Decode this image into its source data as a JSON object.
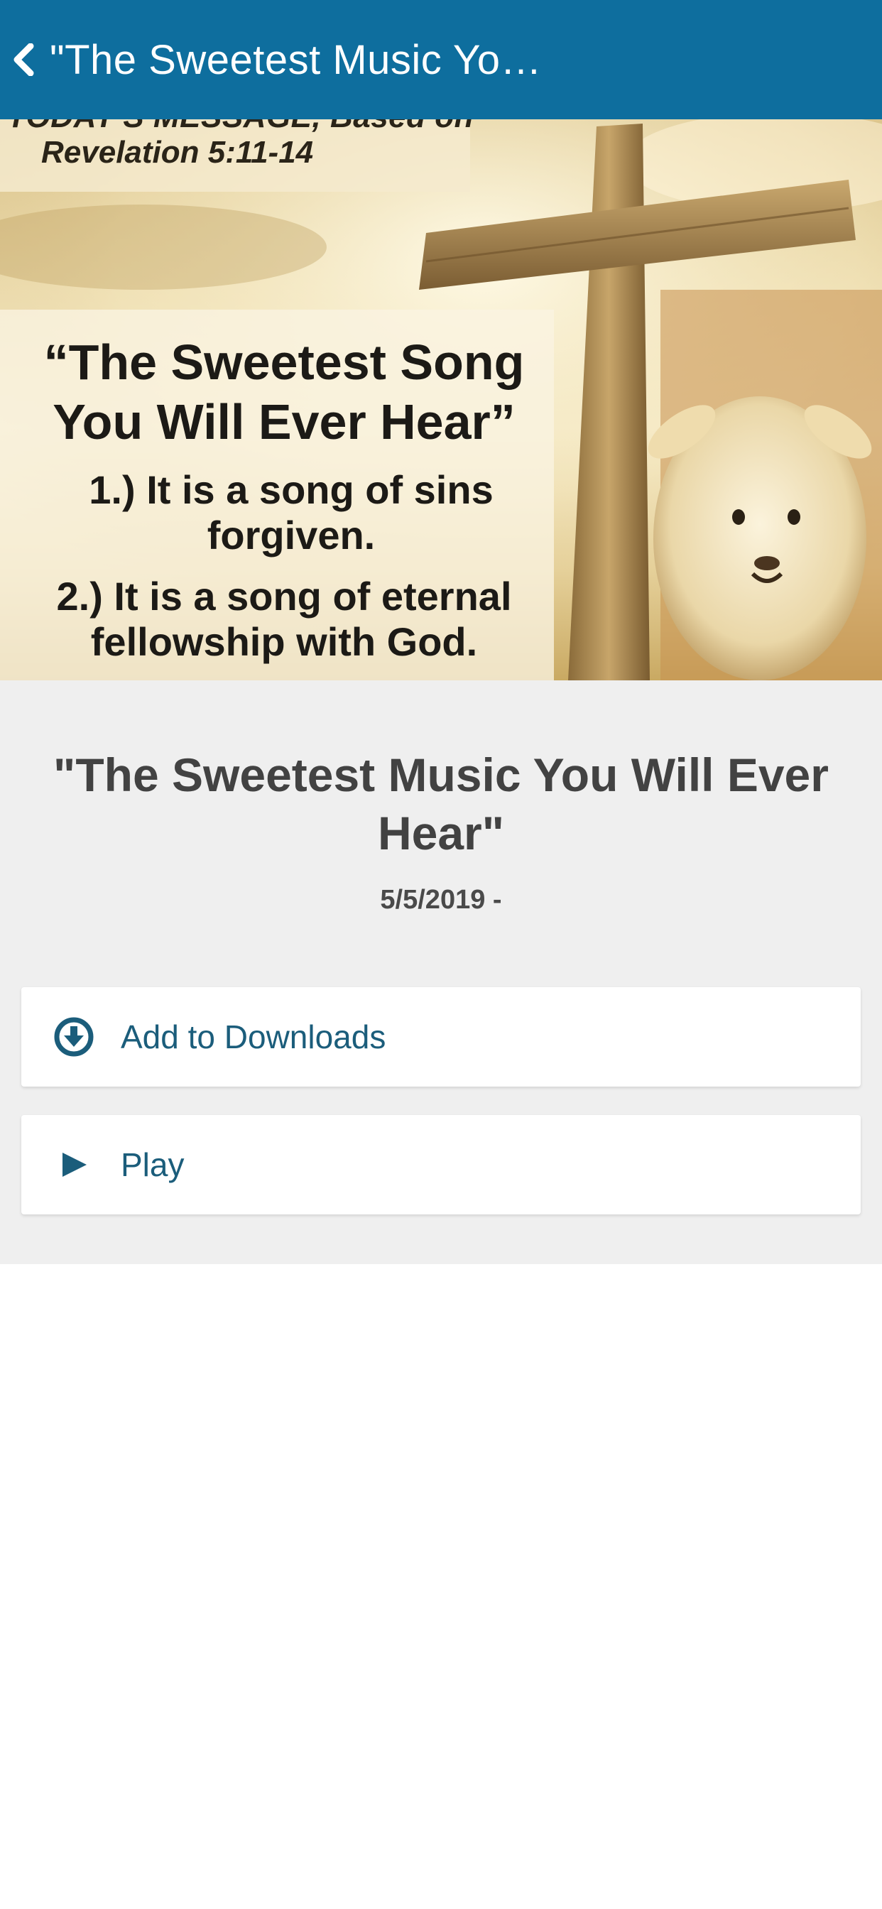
{
  "colors": {
    "nav_bg": "#0e6e9e",
    "accent": "#1b5d7b",
    "panel_bg": "#efefef"
  },
  "nav": {
    "back_icon": "chevron-left-icon",
    "title": "\"The Sweetest Music You…"
  },
  "hero_image": {
    "message_heading": "TODAY'S MESSAGE, Based on",
    "message_reference": "Revelation 5:11-14",
    "song_title_line1": "“The Sweetest Song",
    "song_title_line2": "You Will Ever Hear”",
    "point1_line1": "1.)  It is a song of sins",
    "point1_line2": "forgiven.",
    "point2_line1": "2.)  It is a song of eternal",
    "point2_line2": "fellowship with God."
  },
  "detail": {
    "title": "\"The Sweetest Music You Will Ever Hear\"",
    "date": "5/5/2019 -"
  },
  "actions": {
    "download": {
      "label": "Add to Downloads",
      "icon": "download-circle-icon"
    },
    "play": {
      "label": "Play",
      "icon": "play-icon"
    }
  }
}
